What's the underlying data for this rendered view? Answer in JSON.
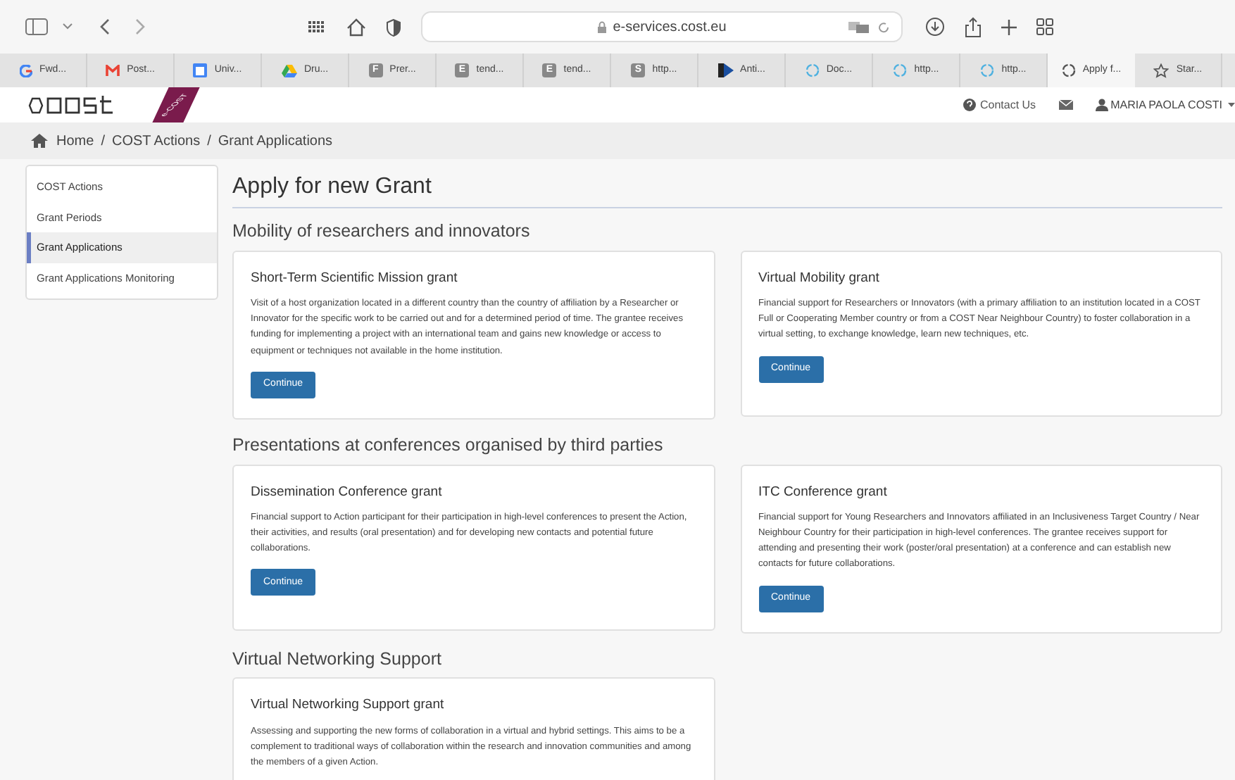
{
  "browser": {
    "url": "e-services.cost.eu"
  },
  "tabs": [
    {
      "kind": "google",
      "label": "Fwd...",
      "selected": false
    },
    {
      "kind": "gmail",
      "label": "Post...",
      "selected": false
    },
    {
      "kind": "calendar",
      "label": "Univ...",
      "selected": false
    },
    {
      "kind": "drive",
      "label": "Dru...",
      "selected": false
    },
    {
      "kind": "letter",
      "letter": "F",
      "label": "Prer...",
      "selected": false
    },
    {
      "kind": "letter",
      "letter": "E",
      "label": "tend...",
      "selected": false
    },
    {
      "kind": "letter",
      "letter": "E",
      "label": "tend...",
      "selected": false
    },
    {
      "kind": "letter",
      "letter": "S",
      "label": "http...",
      "selected": false
    },
    {
      "kind": "play",
      "label": "Anti...",
      "selected": false
    },
    {
      "kind": "loading",
      "label": "Doc...",
      "selected": false
    },
    {
      "kind": "loading",
      "label": "http...",
      "selected": false
    },
    {
      "kind": "loading",
      "label": "http...",
      "selected": false
    },
    {
      "kind": "loading",
      "label": "Apply f...",
      "selected": true
    },
    {
      "kind": "star",
      "label": "Star...",
      "selected": false
    }
  ],
  "header": {
    "ribbon": "e-COST",
    "contact": "Contact Us",
    "user": "MARIA PAOLA COSTI"
  },
  "breadcrumb": {
    "items": [
      "Home",
      "COST Actions",
      "Grant Applications"
    ],
    "separators": [
      "/",
      "/"
    ]
  },
  "sidebar": {
    "items": [
      {
        "label": "COST Actions",
        "selected": false
      },
      {
        "label": "Grant Periods",
        "selected": false
      },
      {
        "label": "Grant Applications",
        "selected": true
      },
      {
        "label": "Grant Applications Monitoring",
        "selected": false
      }
    ]
  },
  "page_title": "Apply for new Grant",
  "sections": [
    {
      "title": "Mobility of researchers and innovators",
      "cards": [
        {
          "title": "Short-Term Scientific Mission grant",
          "text": "Visit of a host organization located in a different country than the country of affiliation by a Researcher or Innovator for the specific work to be carried out and for a determined period of time. The grantee receives funding for implementing a project with an international team and gains new knowledge or access to equipment or techniques not available in the home institution.",
          "button": "Continue"
        },
        {
          "title": "Virtual Mobility grant",
          "text": "Financial support for Researchers or Innovators (with a primary affiliation to an institution located in a COST Full or Cooperating Member country or from a COST Near Neighbour Country) to foster collaboration in a virtual setting, to exchange knowledge, learn new techniques, etc.",
          "button": "Continue"
        }
      ]
    },
    {
      "title": "Presentations at conferences organised by third parties",
      "cards": [
        {
          "title": "Dissemination Conference grant",
          "text": "Financial support to Action participant for their participation in high-level conferences to present the Action, their activities, and results (oral presentation) and for developing new contacts and potential future collaborations.",
          "button": "Continue"
        },
        {
          "title": "ITC Conference grant",
          "text": "Financial support for Young Researchers and Innovators affiliated in an Inclusiveness Target Country / Near Neighbour Country for their participation in high-level conferences. The grantee receives support for attending and presenting their work (poster/oral presentation) at a conference and can establish new contacts for future collaborations.",
          "button": "Continue"
        }
      ]
    },
    {
      "title": "Virtual Networking Support",
      "cards": [
        {
          "title": "Virtual Networking Support grant",
          "text": "Assessing and supporting the new forms of collaboration in a virtual and hybrid settings. This aims to be a complement to traditional ways of collaboration within the research and innovation communities and among the members of a given Action."
        }
      ]
    }
  ]
}
